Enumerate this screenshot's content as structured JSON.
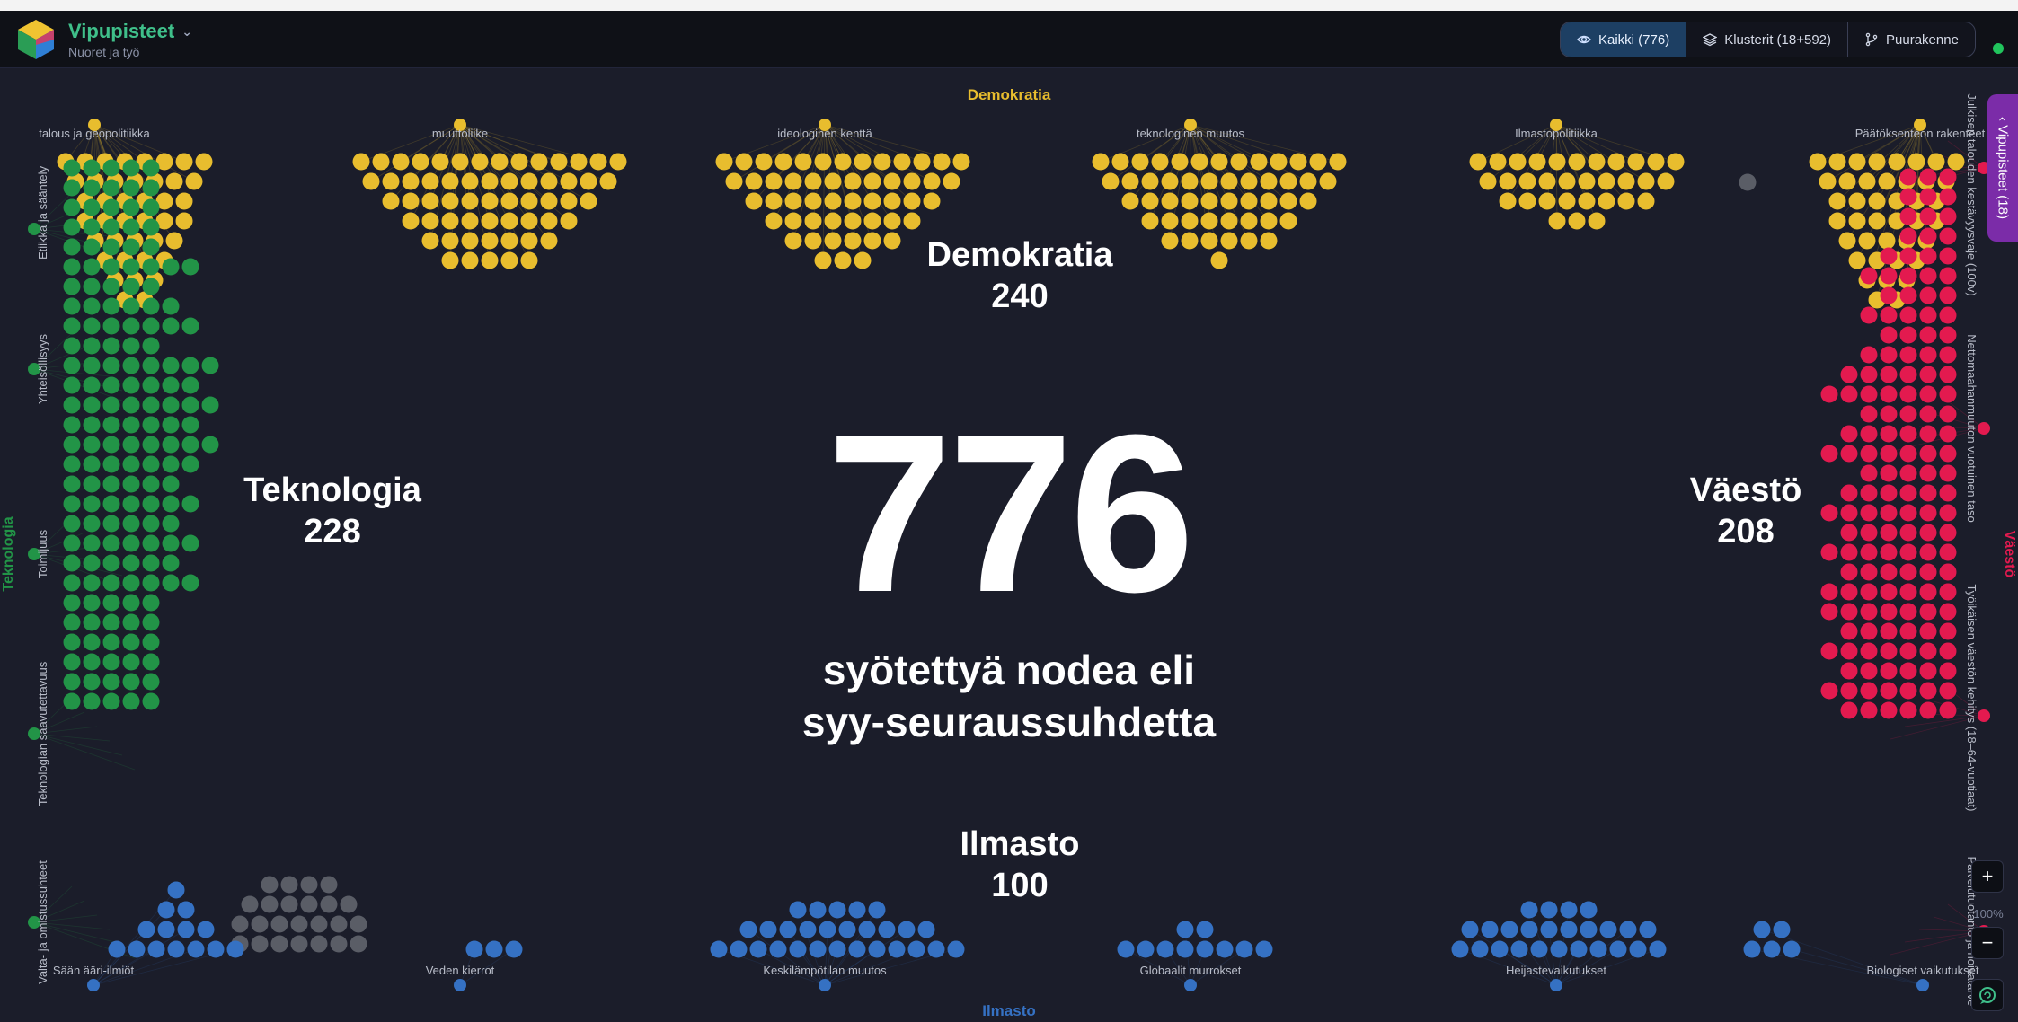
{
  "app": {
    "title": "Vipupisteet",
    "subtitle": "Nuoret ja työ"
  },
  "toolbar": {
    "all_label": "Kaikki (776)",
    "clusters_label": "Klusterit (18+592)",
    "tree_label": "Puurakenne"
  },
  "center": {
    "count": "776",
    "line1": "syötettyä nodea eli",
    "line2": "syy-seuraussuhdetta"
  },
  "clusters": {
    "demokratia": {
      "name": "Demokratia",
      "count": "240"
    },
    "teknologia": {
      "name": "Teknologia",
      "count": "228"
    },
    "vaesto": {
      "name": "Väestö",
      "count": "208"
    },
    "ilmasto": {
      "name": "Ilmasto",
      "count": "100"
    }
  },
  "group_labels": {
    "top": "Demokratia",
    "bottom": "Ilmasto",
    "left": "Teknologia",
    "right": "Väestö"
  },
  "subclusters": {
    "top": [
      "talous ja geopolitiikka",
      "muuttoliike",
      "ideologinen kenttä",
      "teknologinen muutos",
      "Ilmastopolitiikka",
      "Päätöksenteon rakenteet"
    ],
    "bottom": [
      "Sään ääri-ilmiöt",
      "Veden kierrot",
      "Keskilämpötilan muutos",
      "Globaalit murrokset",
      "Heijastevaikutukset",
      "Biologiset vaikutukset"
    ],
    "left": [
      "Etiikka ja sääntely",
      "Yhteisöllisyys",
      "Toimijuus",
      "Teknologian saavutettavuus",
      "Valta- ja omistussuhteet"
    ],
    "right": [
      "Julkisen talouden kestävyysvaje (100v)",
      "Nettomaahanmuuton vuotuinen taso",
      "Työikäisen väestön kehitys (18–64-vuotiaat)",
      "Palvelutuotanto ja hoivatarve"
    ]
  },
  "side_panel": {
    "label": "Vipupisteet (18)"
  },
  "zoom": {
    "level": "100%",
    "plus": "+",
    "minus": "−"
  },
  "colors": {
    "demokratia": "#e8bd2e",
    "teknologia": "#229447",
    "vaesto": "#e31a4f",
    "ilmasto": "#3571c3",
    "unassigned": "#5a5d66",
    "accent": "#3fbf8a",
    "panel": "#7b2ca8"
  },
  "icons": [
    "eye-icon",
    "layers-icon",
    "branch-icon",
    "chevron-down-icon",
    "chevron-left-icon",
    "chat-icon"
  ]
}
